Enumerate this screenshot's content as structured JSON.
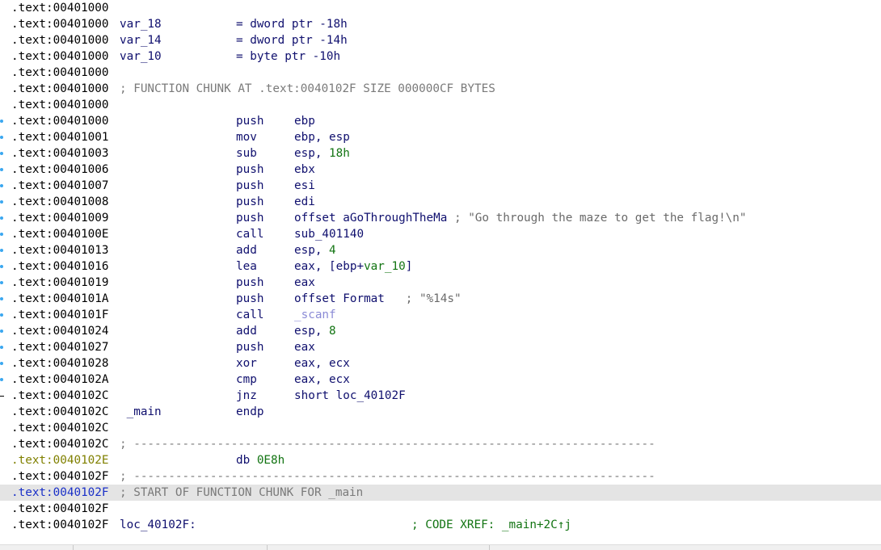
{
  "lines": [
    {
      "addr": ".text:00401000"
    },
    {
      "addr": ".text:00401000",
      "label": "var_18",
      "mnem": "= dword ptr -18h"
    },
    {
      "addr": ".text:00401000",
      "label": "var_14",
      "mnem": "= dword ptr -14h"
    },
    {
      "addr": ".text:00401000",
      "label": "var_10",
      "mnem": "= byte ptr -10h"
    },
    {
      "addr": ".text:00401000"
    },
    {
      "addr": ".text:00401000",
      "comment": "; FUNCTION CHUNK AT .text:0040102F SIZE 000000CF BYTES"
    },
    {
      "addr": ".text:00401000"
    },
    {
      "addr": ".text:00401000",
      "dot": true,
      "mnem": "push",
      "ops": [
        {
          "t": "ebp",
          "c": "reg"
        }
      ]
    },
    {
      "addr": ".text:00401001",
      "dot": true,
      "mnem": "mov",
      "ops": [
        {
          "t": "ebp, esp",
          "c": "reg"
        }
      ]
    },
    {
      "addr": ".text:00401003",
      "dot": true,
      "mnem": "sub",
      "ops": [
        {
          "t": "esp, ",
          "c": "reg"
        },
        {
          "t": "18h",
          "c": "num"
        }
      ]
    },
    {
      "addr": ".text:00401006",
      "dot": true,
      "mnem": "push",
      "ops": [
        {
          "t": "ebx",
          "c": "reg"
        }
      ]
    },
    {
      "addr": ".text:00401007",
      "dot": true,
      "mnem": "push",
      "ops": [
        {
          "t": "esi",
          "c": "reg"
        }
      ]
    },
    {
      "addr": ".text:00401008",
      "dot": true,
      "mnem": "push",
      "ops": [
        {
          "t": "edi",
          "c": "reg"
        }
      ]
    },
    {
      "addr": ".text:00401009",
      "dot": true,
      "mnem": "push",
      "ops": [
        {
          "t": "offset aGoThroughTheMa",
          "c": "reg"
        },
        {
          "t": " ; \"Go through the maze to get the flag!\\n\"",
          "c": "cmt"
        }
      ]
    },
    {
      "addr": ".text:0040100E",
      "dot": true,
      "mnem": "call",
      "ops": [
        {
          "t": "sub_401140",
          "c": "reg"
        }
      ]
    },
    {
      "addr": ".text:00401013",
      "dot": true,
      "mnem": "add",
      "ops": [
        {
          "t": "esp, ",
          "c": "reg"
        },
        {
          "t": "4",
          "c": "num"
        }
      ]
    },
    {
      "addr": ".text:00401016",
      "dot": true,
      "mnem": "lea",
      "ops": [
        {
          "t": "eax, [ebp+",
          "c": "reg"
        },
        {
          "t": "var_10",
          "c": "num"
        },
        {
          "t": "]",
          "c": "reg"
        }
      ]
    },
    {
      "addr": ".text:00401019",
      "dot": true,
      "mnem": "push",
      "ops": [
        {
          "t": "eax",
          "c": "reg"
        }
      ]
    },
    {
      "addr": ".text:0040101A",
      "dot": true,
      "mnem": "push",
      "ops": [
        {
          "t": "offset Format",
          "c": "reg"
        },
        {
          "t": "   ; \"%14s\"",
          "c": "cmt"
        }
      ]
    },
    {
      "addr": ".text:0040101F",
      "dot": true,
      "mnem": "call",
      "ops": [
        {
          "t": "_scanf",
          "c": "lib"
        }
      ]
    },
    {
      "addr": ".text:00401024",
      "dot": true,
      "mnem": "add",
      "ops": [
        {
          "t": "esp, ",
          "c": "reg"
        },
        {
          "t": "8",
          "c": "num"
        }
      ]
    },
    {
      "addr": ".text:00401027",
      "dot": true,
      "mnem": "push",
      "ops": [
        {
          "t": "eax",
          "c": "reg"
        }
      ]
    },
    {
      "addr": ".text:00401028",
      "dot": true,
      "mnem": "xor",
      "ops": [
        {
          "t": "eax, ecx",
          "c": "reg"
        }
      ]
    },
    {
      "addr": ".text:0040102A",
      "dot": true,
      "mnem": "cmp",
      "ops": [
        {
          "t": "eax, ecx",
          "c": "reg"
        }
      ]
    },
    {
      "addr": ".text:0040102C",
      "dash": true,
      "mnem": "jnz",
      "ops": [
        {
          "t": "short loc_40102F",
          "c": "reg"
        }
      ]
    },
    {
      "addr": ".text:0040102C",
      "label": " _main",
      "mnem": "endp"
    },
    {
      "addr": ".text:0040102C"
    },
    {
      "addr": ".text:0040102C",
      "comment": "; ---------------------------------------------------------------------------"
    },
    {
      "addr": ".text:0040102E",
      "olive": true,
      "mnem": "db 0E8h",
      "mnemColor": "#127412"
    },
    {
      "addr": ".text:0040102F",
      "comment": "; ---------------------------------------------------------------------------"
    },
    {
      "addr": ".text:0040102F",
      "selected": true,
      "comment": "; START OF FUNCTION CHUNK FOR _main"
    },
    {
      "addr": ".text:0040102F"
    },
    {
      "addr": ".text:0040102F",
      "label": "loc_40102F:",
      "xref": "; CODE XREF: _main+2C↑j"
    }
  ]
}
